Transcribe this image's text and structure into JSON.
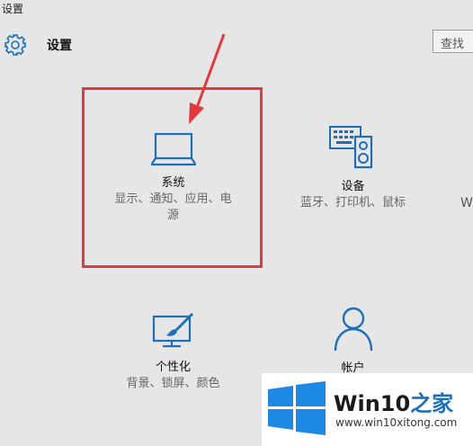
{
  "window": {
    "title": "设置"
  },
  "header": {
    "title": "设置",
    "search_placeholder": "查找"
  },
  "tiles": [
    {
      "name": "系统",
      "desc_line1": "显示、通知、应用、电",
      "desc_line2": "源",
      "icon": "laptop-icon"
    },
    {
      "name": "设备",
      "desc_line1": "蓝牙、打印机、鼠标",
      "icon": "devices-icon"
    },
    {
      "name": "个性化",
      "desc_line1": "背景、锁屏、颜色",
      "icon": "personalization-icon"
    },
    {
      "name": "帐户",
      "icon": "person-icon"
    }
  ],
  "partial_tile_letter": "W",
  "watermark": {
    "brand": "Win10",
    "suffix": "之家",
    "url": "www.win10xitong.com"
  },
  "colors": {
    "accent": "#1e6fb8",
    "highlight": "#e0393e",
    "background": "#e6e6e6"
  }
}
